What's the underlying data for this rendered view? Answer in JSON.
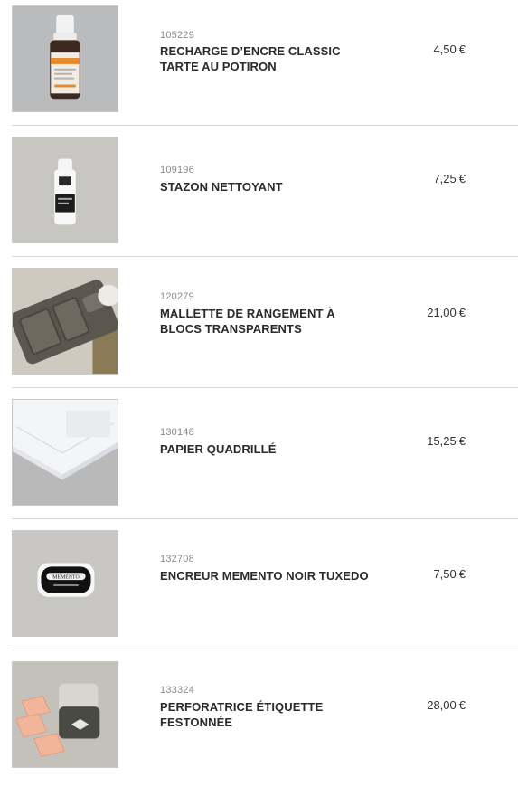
{
  "currency": "€",
  "products": [
    {
      "sku": "105229",
      "name": "RECHARGE D’ENCRE CLASSIC TARTE AU POTIRON",
      "price": "4,50",
      "image_icon": "ink-refill-bottle-icon"
    },
    {
      "sku": "109196",
      "name": "STAZON NETTOYANT",
      "price": "7,25",
      "image_icon": "cleaner-bottle-icon"
    },
    {
      "sku": "120279",
      "name": "MALLETTE DE RANGEMENT À BLOCS TRANSPARENTS",
      "price": "21,00",
      "image_icon": "storage-case-icon"
    },
    {
      "sku": "130148",
      "name": "PAPIER QUADRILLÉ",
      "price": "15,25",
      "image_icon": "grid-paper-icon"
    },
    {
      "sku": "132708",
      "name": "ENCREUR MEMENTO NOIR TUXEDO",
      "price": "7,50",
      "image_icon": "ink-pad-icon",
      "image_label": "MEMENTO"
    },
    {
      "sku": "133324",
      "name": "PERFORATRICE ÉTIQUETTE FESTONNÉE",
      "price": "28,00",
      "image_icon": "punch-tool-icon"
    }
  ]
}
